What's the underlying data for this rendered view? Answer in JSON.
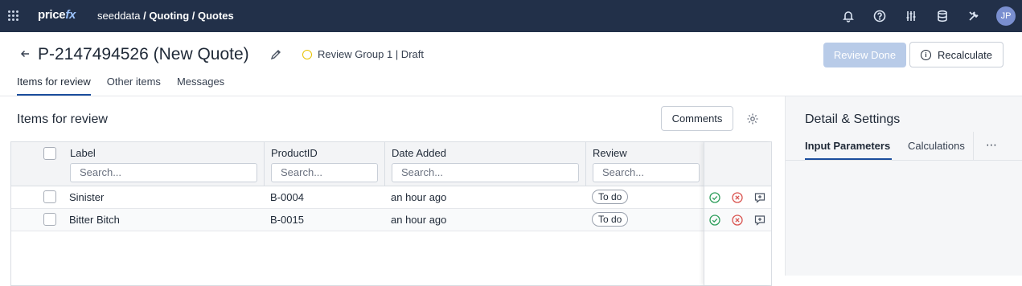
{
  "topbar": {
    "logo_price": "price",
    "logo_fx": "fx",
    "breadcrumb_first": "seeddata",
    "breadcrumb_rest": " / Quoting / Quotes",
    "icons": [
      "bell-icon",
      "help-icon",
      "sliders-icon",
      "database-icon",
      "tools-icon"
    ],
    "avatar": "JP"
  },
  "header": {
    "title": "P-2147494526 (New Quote)",
    "status": "Review Group 1 | Draft",
    "review_done_label": "Review Done",
    "recalculate_label": "Recalculate",
    "info_glyph": "i"
  },
  "tabs": [
    "Items for review",
    "Other items",
    "Messages"
  ],
  "section": {
    "title": "Items for review",
    "comments_label": "Comments"
  },
  "grid": {
    "columns": [
      {
        "label": "Label",
        "placeholder": "Search..."
      },
      {
        "label": "ProductID",
        "placeholder": "Search..."
      },
      {
        "label": "Date Added",
        "placeholder": "Search..."
      },
      {
        "label": "Review",
        "placeholder": "Search..."
      }
    ],
    "rows": [
      {
        "label": "Sinister",
        "product_id": "B-0004",
        "date_added": "an hour ago",
        "review": "To do"
      },
      {
        "label": "Bitter Bitch",
        "product_id": "B-0015",
        "date_added": "an hour ago",
        "review": "To do"
      }
    ]
  },
  "panel": {
    "title": "Detail & Settings",
    "tabs": [
      "Input Parameters",
      "Calculations"
    ],
    "more": "⋯"
  },
  "colors": {
    "topbar": "#223049",
    "accent": "#1b4d9c",
    "approve": "#2e9e5b",
    "reject": "#d9534f",
    "status_ring": "#e8c200"
  }
}
